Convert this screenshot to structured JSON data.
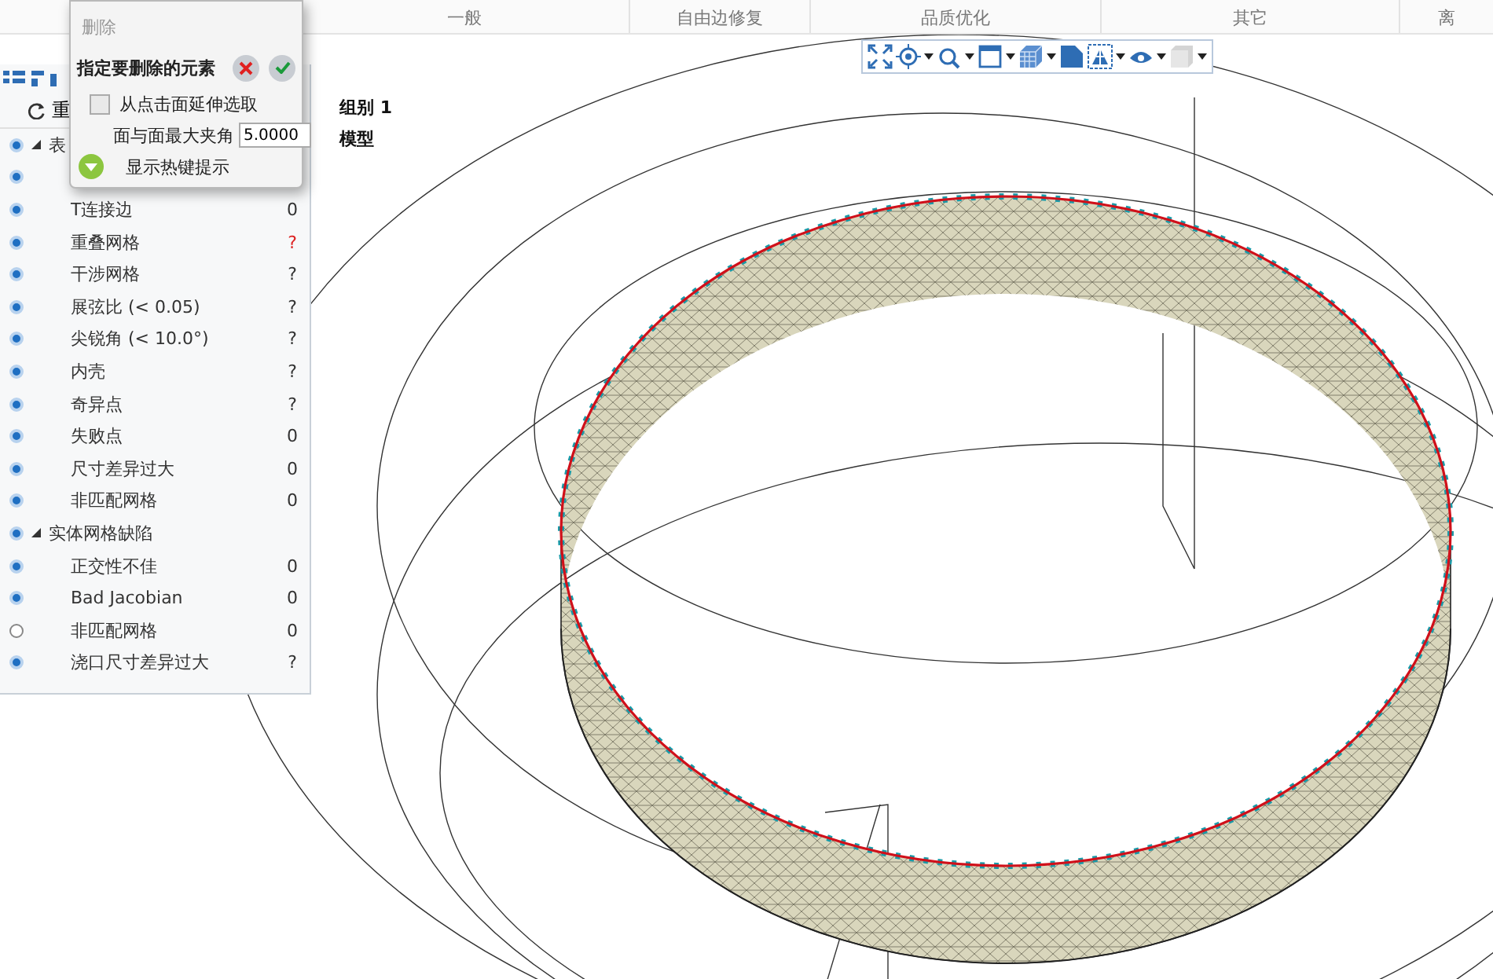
{
  "ribbon": {
    "groups": [
      "一般",
      "自由边修复",
      "品质优化",
      "其它",
      "离"
    ]
  },
  "view_toolbar": {
    "tools": [
      {
        "kind": "fit",
        "dropdown": false
      },
      {
        "kind": "center",
        "dropdown": true
      },
      {
        "kind": "zoom",
        "dropdown": true
      },
      {
        "kind": "window",
        "dropdown": true
      },
      {
        "kind": "cube",
        "dropdown": true
      },
      {
        "kind": "page",
        "dropdown": false
      },
      {
        "kind": "mesh",
        "dropdown": true
      },
      {
        "kind": "eye",
        "dropdown": true
      },
      {
        "kind": "box",
        "dropdown": true
      }
    ]
  },
  "panel": {
    "refresh_label": "重",
    "tree": [
      {
        "label": "表",
        "selected": true,
        "expanded": true,
        "children": [
          {
            "selected": true
          },
          {
            "label": "T连接边",
            "value": "0",
            "flagged": false,
            "selected": true
          },
          {
            "label": "重叠网格",
            "value": "?",
            "flagged": true,
            "selected": true
          },
          {
            "label": "干涉网格",
            "value": "?",
            "flagged": false,
            "selected": true
          },
          {
            "label": "展弦比 (< 0.05)",
            "value": "?",
            "flagged": false,
            "selected": true
          },
          {
            "label": "尖锐角 (< 10.0°)",
            "value": "?",
            "flagged": false,
            "selected": true
          },
          {
            "label": "内壳",
            "value": "?",
            "flagged": false,
            "selected": true
          },
          {
            "label": "奇异点",
            "value": "?",
            "flagged": false,
            "selected": true
          },
          {
            "label": "失败点",
            "value": "0",
            "flagged": false,
            "selected": true
          },
          {
            "label": "尺寸差异过大",
            "value": "0",
            "flagged": false,
            "selected": true
          },
          {
            "label": "非匹配网格",
            "value": "0",
            "flagged": false,
            "selected": true
          }
        ]
      },
      {
        "label": "实体网格缺陷",
        "selected": true,
        "expanded": true,
        "children": [
          {
            "label": "正交性不佳",
            "value": "0",
            "flagged": false,
            "selected": true
          },
          {
            "label": "Bad Jacobian",
            "value": "0",
            "flagged": false,
            "selected": true
          },
          {
            "label": "非匹配网格",
            "value": "0",
            "flagged": false,
            "selected": false
          },
          {
            "label": "浇口尺寸差异过大",
            "value": "?",
            "flagged": false,
            "selected": true
          }
        ]
      }
    ]
  },
  "viewport": {
    "labels": [
      "组别 1",
      "模型"
    ]
  },
  "dialog": {
    "title": "删除",
    "heading": "指定要删除的元素",
    "extend_option": {
      "label": "从点击面延伸选取",
      "checked": false
    },
    "angle_field": {
      "label": "面与面最大夹角",
      "value": "5.0000"
    },
    "hotkey_hint": {
      "label": "显示热键提示",
      "expanded": false
    }
  }
}
